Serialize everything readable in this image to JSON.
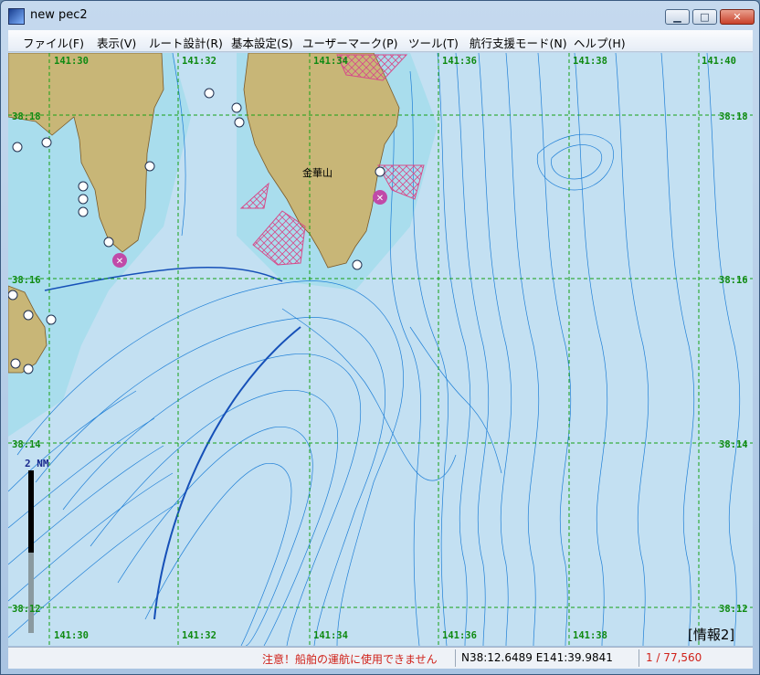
{
  "window": {
    "title": "new pec2"
  },
  "menu": [
    "ファイル(F)",
    "表示(V)",
    "ルート設計(R)",
    "基本設定(S)",
    "ユーザーマーク(P)",
    "ツール(T)",
    "航行支援モード(N)",
    "ヘルプ(H)"
  ],
  "map": {
    "lon_labels": [
      "141:30",
      "141:32",
      "141:34",
      "141:36",
      "141:38",
      "141:40"
    ],
    "lat_labels": [
      "38:18",
      "38:16",
      "38:14",
      "38:12"
    ],
    "place_label": "金華山",
    "scale_label": "2 NM",
    "info_label": "[情報2]",
    "colors": {
      "land": "#c8b677",
      "sea": "#c3e0f2",
      "contour": "#1f7fd6",
      "grid": "#16a014",
      "marker": "#c04aa8"
    }
  },
  "status": {
    "warning": "注意！船舶の運航に使用できません",
    "coords": "N38:12.6489 E141:39.9841",
    "scale": "1 / 77,560"
  }
}
